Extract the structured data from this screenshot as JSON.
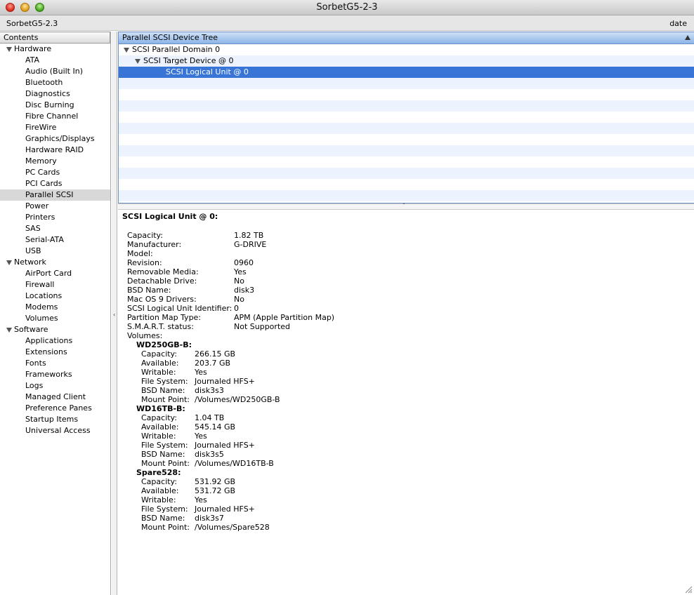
{
  "window": {
    "title": "SorbetG5-2-3"
  },
  "infobar": {
    "computer_name": "SorbetG5-2.3",
    "date_label": "date"
  },
  "sidebar": {
    "header": "Contents",
    "categories": [
      {
        "label": "Hardware",
        "items": [
          "ATA",
          "Audio (Built In)",
          "Bluetooth",
          "Diagnostics",
          "Disc Burning",
          "Fibre Channel",
          "FireWire",
          "Graphics/Displays",
          "Hardware RAID",
          "Memory",
          "PC Cards",
          "PCI Cards",
          "Parallel SCSI",
          "Power",
          "Printers",
          "SAS",
          "Serial-ATA",
          "USB"
        ]
      },
      {
        "label": "Network",
        "items": [
          "AirPort Card",
          "Firewall",
          "Locations",
          "Modems",
          "Volumes"
        ]
      },
      {
        "label": "Software",
        "items": [
          "Applications",
          "Extensions",
          "Fonts",
          "Frameworks",
          "Logs",
          "Managed Client",
          "Preference Panes",
          "Startup Items",
          "Universal Access"
        ]
      }
    ],
    "selected_item": "Parallel SCSI"
  },
  "device_tree": {
    "header": "Parallel SCSI Device Tree",
    "rows": [
      {
        "label": "SCSI Parallel Domain 0",
        "level": 0,
        "expanded": true
      },
      {
        "label": "SCSI Target Device @ 0",
        "level": 1,
        "expanded": true
      },
      {
        "label": "SCSI Logical Unit @ 0",
        "level": 2,
        "selected": true
      }
    ],
    "empty_rows": 11
  },
  "detail": {
    "title": "SCSI Logical Unit @ 0:",
    "properties": [
      {
        "key": "Capacity:",
        "value": "1.82 TB"
      },
      {
        "key": "Manufacturer:",
        "value": "G-DRIVE"
      },
      {
        "key": "Model:",
        "value": ""
      },
      {
        "key": "Revision:",
        "value": "0960"
      },
      {
        "key": "Removable Media:",
        "value": "Yes"
      },
      {
        "key": "Detachable Drive:",
        "value": "No"
      },
      {
        "key": "BSD Name:",
        "value": "disk3"
      },
      {
        "key": "Mac OS 9 Drivers:",
        "value": "No"
      },
      {
        "key": "SCSI Logical Unit Identifier:",
        "value": "0"
      },
      {
        "key": "Partition Map Type:",
        "value": "APM (Apple Partition Map)"
      },
      {
        "key": "S.M.A.R.T. status:",
        "value": "Not Supported"
      },
      {
        "key": "Volumes:",
        "value": ""
      }
    ],
    "volumes": [
      {
        "name": "WD250GB-B:",
        "fields": [
          {
            "key": "Capacity:",
            "value": "266.15 GB"
          },
          {
            "key": "Available:",
            "value": "203.7 GB"
          },
          {
            "key": "Writable:",
            "value": "Yes"
          },
          {
            "key": "File System:",
            "value": "Journaled HFS+"
          },
          {
            "key": "BSD Name:",
            "value": "disk3s3"
          },
          {
            "key": "Mount Point:",
            "value": "/Volumes/WD250GB-B"
          }
        ]
      },
      {
        "name": "WD16TB-B:",
        "fields": [
          {
            "key": "Capacity:",
            "value": "1.04 TB"
          },
          {
            "key": "Available:",
            "value": "545.14 GB"
          },
          {
            "key": "Writable:",
            "value": "Yes"
          },
          {
            "key": "File System:",
            "value": "Journaled HFS+"
          },
          {
            "key": "BSD Name:",
            "value": "disk3s5"
          },
          {
            "key": "Mount Point:",
            "value": "/Volumes/WD16TB-B"
          }
        ]
      },
      {
        "name": "Spare528:",
        "fields": [
          {
            "key": "Capacity:",
            "value": "531.92 GB"
          },
          {
            "key": "Available:",
            "value": "531.72 GB"
          },
          {
            "key": "Writable:",
            "value": "Yes"
          },
          {
            "key": "File System:",
            "value": "Journaled HFS+"
          },
          {
            "key": "BSD Name:",
            "value": "disk3s7"
          },
          {
            "key": "Mount Point:",
            "value": "/Volumes/Spare528"
          }
        ]
      }
    ]
  },
  "colors": {
    "selection": "#3875d7",
    "sidebar_selection": "#d8d8d8",
    "stripe": "#edf3fe"
  },
  "icons": [
    "close-button",
    "minimize-button",
    "zoom-button",
    "disclosure-triangle-icon",
    "sort-ascending-icon",
    "resize-grip-icon"
  ]
}
